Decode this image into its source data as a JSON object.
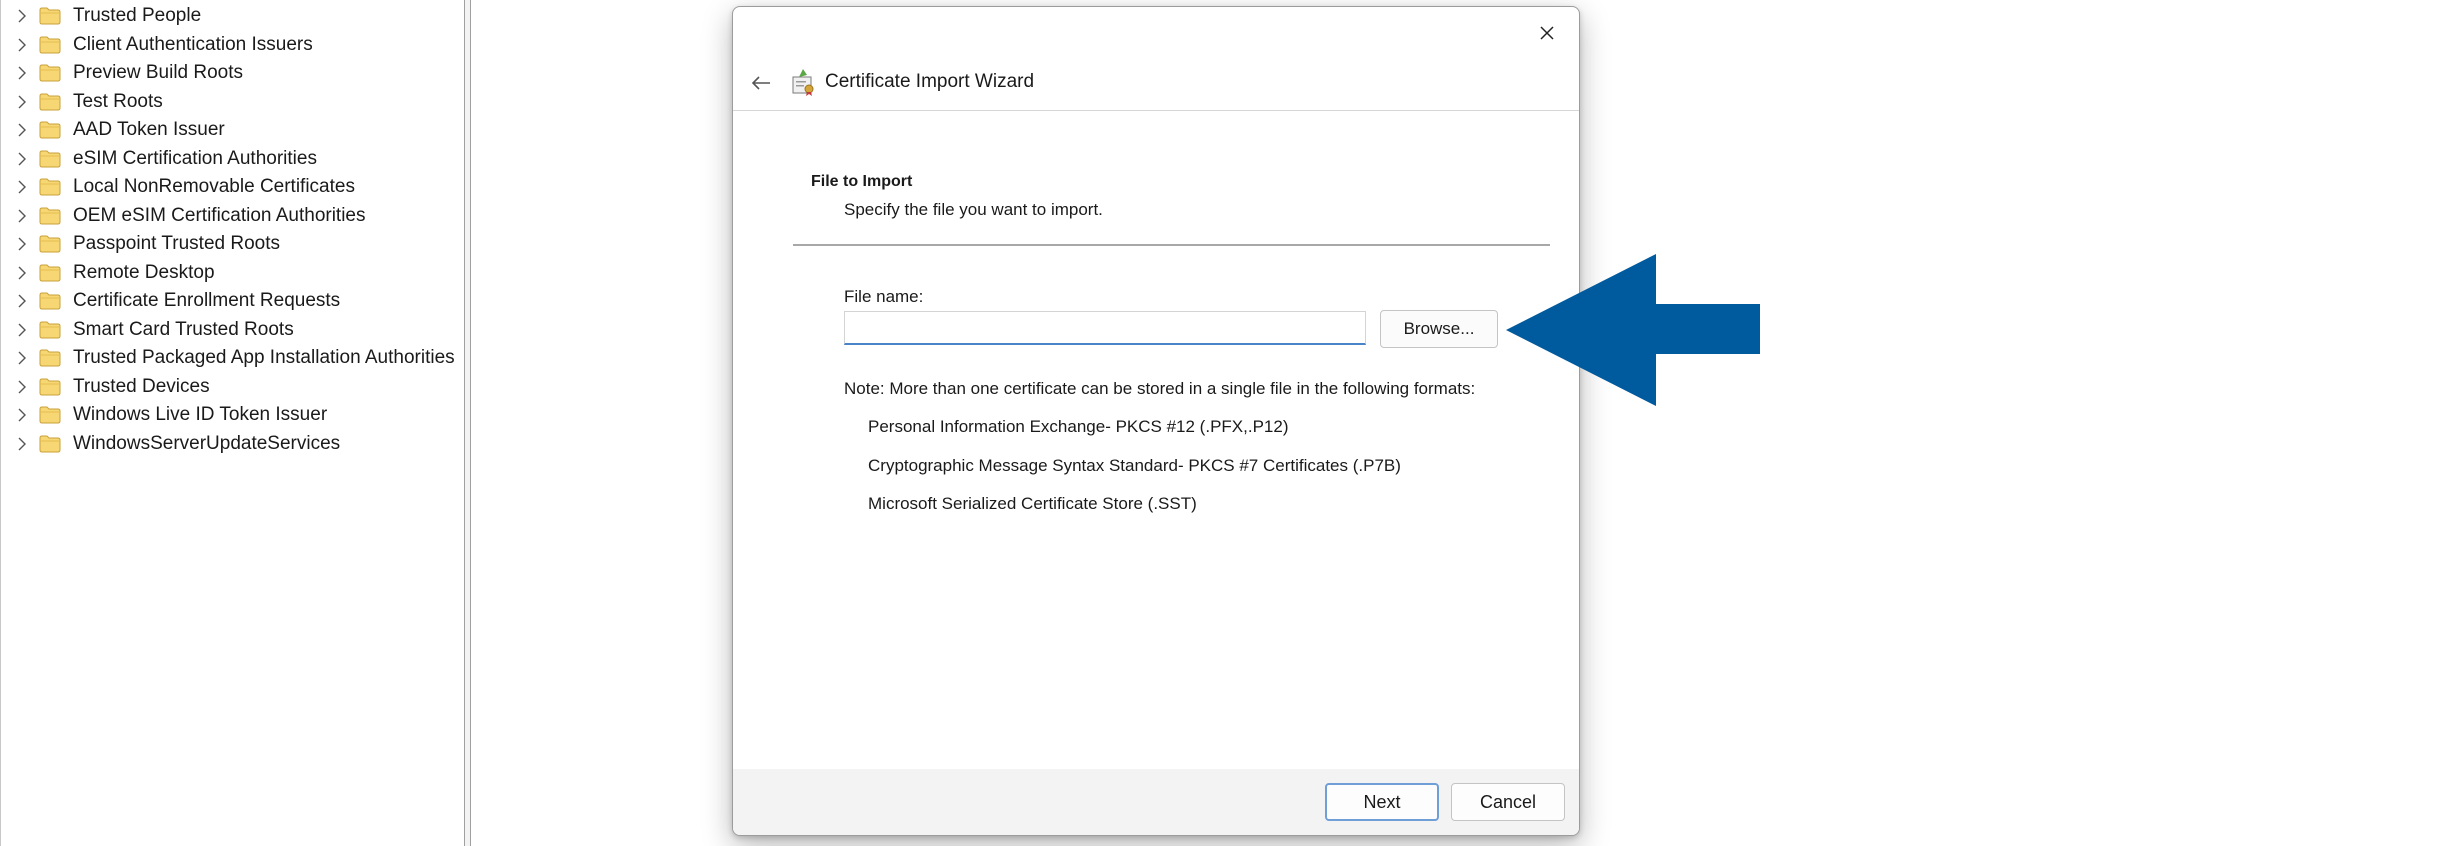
{
  "tree": {
    "items": [
      {
        "label": "Trusted People"
      },
      {
        "label": "Client Authentication Issuers"
      },
      {
        "label": "Preview Build Roots"
      },
      {
        "label": "Test Roots"
      },
      {
        "label": "AAD Token Issuer"
      },
      {
        "label": "eSIM Certification Authorities"
      },
      {
        "label": "Local NonRemovable Certificates"
      },
      {
        "label": "OEM eSIM Certification Authorities"
      },
      {
        "label": "Passpoint Trusted Roots"
      },
      {
        "label": "Remote Desktop"
      },
      {
        "label": "Certificate Enrollment Requests"
      },
      {
        "label": "Smart Card Trusted Roots"
      },
      {
        "label": "Trusted Packaged App Installation Authorities"
      },
      {
        "label": "Trusted Devices"
      },
      {
        "label": "Windows Live ID Token Issuer"
      },
      {
        "label": "WindowsServerUpdateServices"
      }
    ],
    "item_icon": "folder-icon",
    "expander_icon": "chevron-right-icon"
  },
  "dialog": {
    "title": "Certificate Import Wizard",
    "section_title": "File to Import",
    "section_subtitle": "Specify the file you want to import.",
    "file_label": "File name:",
    "file_value": "",
    "browse_label": "Browse...",
    "note": "Note:  More than one certificate can be stored in a single file in the following formats:",
    "formats": [
      "Personal Information Exchange- PKCS #12 (.PFX,.P12)",
      "Cryptographic Message Syntax Standard- PKCS #7 Certificates (.P7B)",
      "Microsoft Serialized Certificate Store (.SST)"
    ],
    "next_label": "Next",
    "cancel_label": "Cancel"
  },
  "colors": {
    "arrow": "#005a9e",
    "focus": "#4a84c8",
    "folder": "#f7d774"
  }
}
